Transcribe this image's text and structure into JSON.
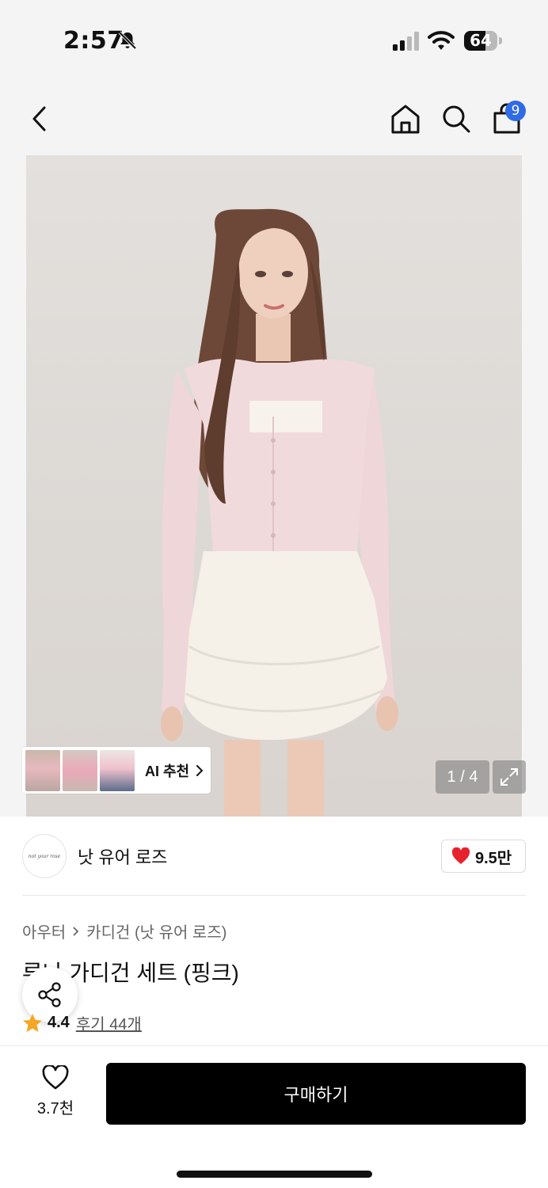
{
  "status_bar": {
    "time": "2:57",
    "battery": "64",
    "battery_level": 0.64
  },
  "nav": {
    "cart_count": "9"
  },
  "gallery": {
    "ai_label": "AI 추천",
    "counter": "1 / 4"
  },
  "brand": {
    "name": "낫 유어 로즈",
    "logo_text": "not your rose",
    "likes": "9.5만"
  },
  "product": {
    "breadcrumb": [
      "아우터",
      "카디건 (낫 유어 로즈)"
    ],
    "title": "루나 가디건 세트 (핑크)",
    "rating": "4.4",
    "reviews": "후기 44개"
  },
  "bottom": {
    "wish_count": "3.7천",
    "buy_label": "구매하기"
  },
  "colors": {
    "accent": "#2f6be6",
    "heart": "#e8222d",
    "star": "#f5a623",
    "buy_button": "#000000"
  }
}
